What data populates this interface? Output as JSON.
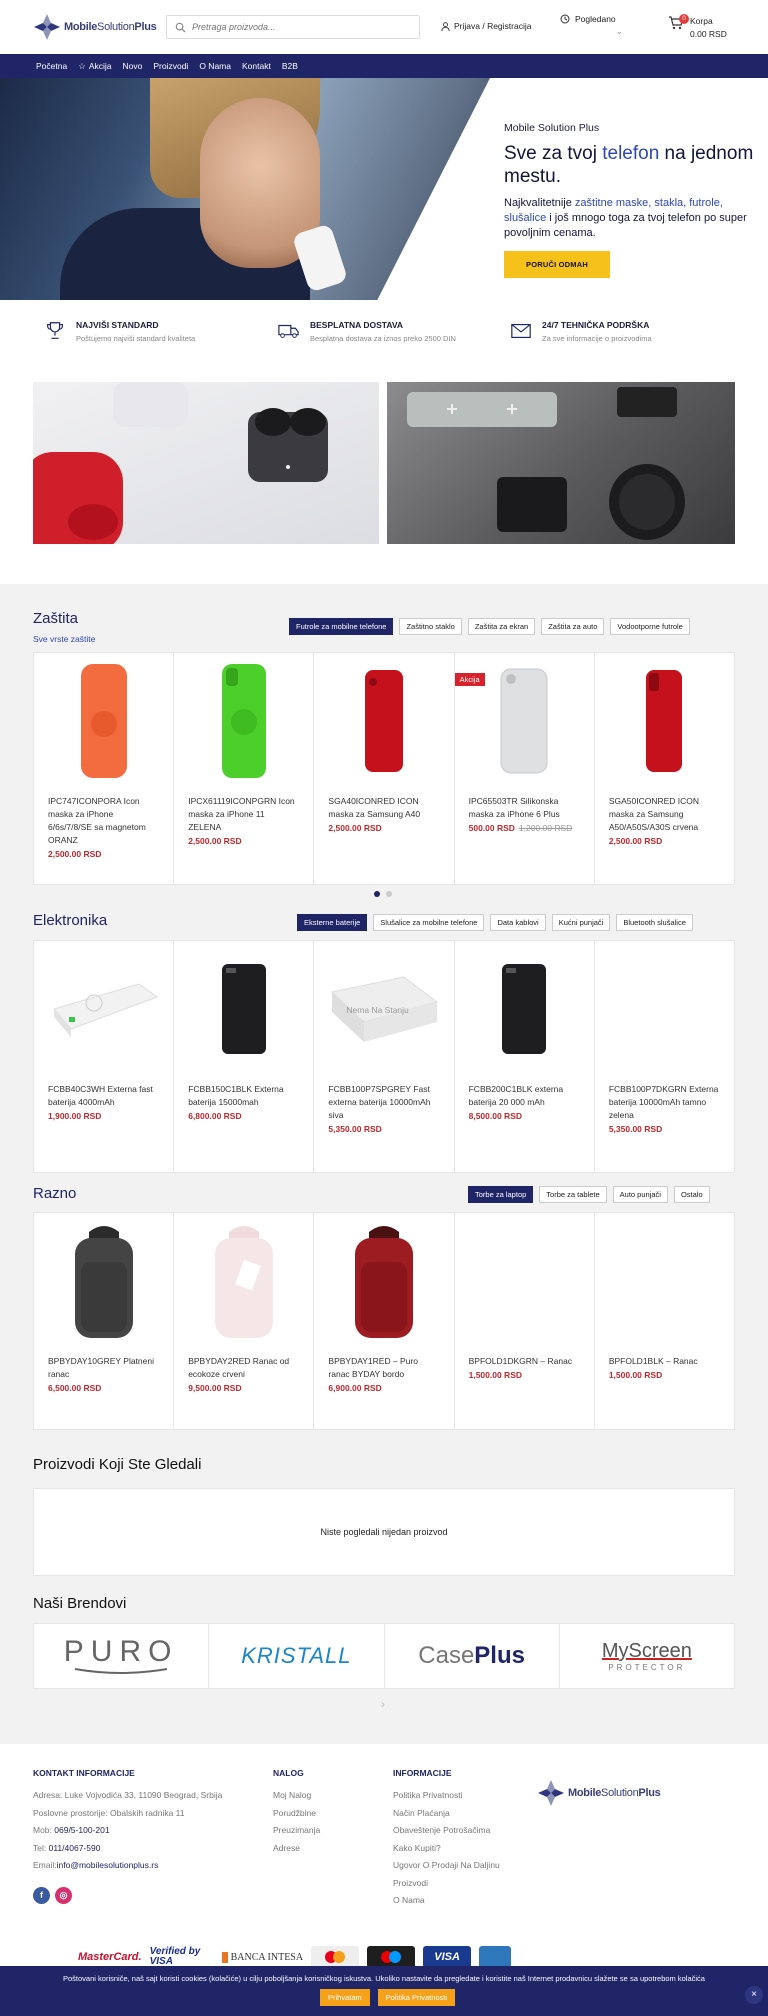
{
  "header": {
    "logo_text_a": "Mobile",
    "logo_text_b": "Solution",
    "logo_text_c": "Plus",
    "search_placeholder": "Pretraga proizvoda...",
    "login_label": "Prijava / Registracija",
    "viewed_label": "Pogledano",
    "cart_label": "Korpa",
    "cart_total": "0.00 RSD",
    "cart_count": "0"
  },
  "nav": {
    "items": [
      "Početna",
      "Akcija",
      "Novo",
      "Proizvodi",
      "O Nama",
      "Kontakt",
      "B2B"
    ]
  },
  "hero": {
    "kicker": "Mobile Solution Plus",
    "title_a": "Sve za tvoj ",
    "title_hl": "telefon",
    "title_b": " na jednom mestu.",
    "text_a": "Najkvalitetnije ",
    "text_hl1": "zaštitne maske, stakla, futrole, slušalice",
    "text_b": " i još mnogo toga za tvoj telefon po super povoljnim cenama.",
    "button": "PORUČI ODMAH"
  },
  "features": [
    {
      "title": "NAJVIŠI STANDARD",
      "sub": "Poštujemo najviši standard kvaliteta",
      "icon": "trophy-icon"
    },
    {
      "title": "BESPLATNA DOSTAVA",
      "sub": "Besplatna dostava za iznos preko 2500 DIN",
      "icon": "truck-icon"
    },
    {
      "title": "24/7 TEHNIČKA PODRŠKA",
      "sub": "Za sve informacije o proizvodima",
      "icon": "mail-icon"
    }
  ],
  "zastita": {
    "title": "Zaštita",
    "sub": "Sve vrste zaštite",
    "tabs": [
      "Futrole za mobilne telefone",
      "Zaštitno staklo",
      "Zaštita za ekran",
      "Zaštita za auto",
      "Vodootporne futrole"
    ],
    "products": [
      {
        "name": "IPC747ICONPORA Icon maska za iPhone 6/6s/7/8/SE sa magnetom ORANZ",
        "price": "2,500.00 RSD",
        "old": "",
        "badge": ""
      },
      {
        "name": "IPCX61119ICONPGRN Icon maska za iPhone 11 ZELENA",
        "price": "2,500.00 RSD",
        "old": "",
        "badge": ""
      },
      {
        "name": "SGA40ICONRED ICON maska za Samsung A40",
        "price": "2,500.00 RSD",
        "old": "",
        "badge": ""
      },
      {
        "name": "IPC65503TR Silikonska maska za iPhone 6 Plus",
        "price": "500.00 RSD",
        "old": "1,200.00 RSD",
        "badge": "Akcija"
      },
      {
        "name": "SGA50ICONRED ICON maska za Samsung A50/A50S/A30S crvena",
        "price": "2,500.00 RSD",
        "old": "",
        "badge": ""
      }
    ]
  },
  "elektronika": {
    "title": "Elektronika",
    "tabs": [
      "Eksterne baterije",
      "Slušalice za mobilne telefone",
      "Data kablovi",
      "Kućni punjači",
      "Bluetooth slušalice"
    ],
    "products": [
      {
        "name": "FCBB40C3WH Externa fast baterija 4000mAh",
        "price": "1,900.00 RSD"
      },
      {
        "name": "FCBB150C1BLK Externa baterija 15000mah",
        "price": "6,800.00 RSD"
      },
      {
        "name": "FCBB100P7SPGREY Fast externa baterija 10000mAh siva",
        "price": "5,350.00 RSD",
        "overlay": "Nema Na Stanju"
      },
      {
        "name": "FCBB200C1BLK externa baterija 20 000 mAh",
        "price": "8,500.00 RSD"
      },
      {
        "name": "FCBB100P7DKGRN Externa baterija 10000mAh tamno zelena",
        "price": "5,350.00 RSD"
      }
    ]
  },
  "razno": {
    "title": "Razno",
    "tabs": [
      "Torbe za laptop",
      "Torbe za tablete",
      "Auto punjači",
      "Ostalo"
    ],
    "products": [
      {
        "name": "BPBYDAY10GREY Platneni ranac",
        "price": "6,500.00 RSD"
      },
      {
        "name": "BPBYDAY2RED Ranac od ecokoze crveni",
        "price": "9,500.00 RSD"
      },
      {
        "name": "BPBYDAY1RED – Puro ranac BYDAY bordo",
        "price": "6,900.00 RSD"
      },
      {
        "name": "BPFOLD1DKGRN – Ranac",
        "price": "1,500.00 RSD"
      },
      {
        "name": "BPFOLD1BLK – Ranac",
        "price": "1,500.00 RSD"
      }
    ]
  },
  "viewed": {
    "title": "Proizvodi Koji Ste Gledali",
    "empty": "Niste pogledali nijedan proizvod"
  },
  "brands": {
    "title": "Naši Brendovi",
    "items": [
      "PURO",
      "KRISTALL",
      "Case",
      "Plus",
      "MyScreen",
      "PROTECTOR"
    ]
  },
  "footer": {
    "contact_title": "KONTAKT INFORMACIJE",
    "address": "Adresa: Luke Vojvodića 33, 11090 Beograd, Srbija",
    "office": "Poslovne prostorije: Obalskih radnika 11",
    "mob_label": "Mob: ",
    "mob": "069/5-100-201",
    "tel_label": "Tel: ",
    "tel": "011/4067-590",
    "email_label": "Email:",
    "email": "info@mobilesolutionplus.rs",
    "account_title": "NALOG",
    "account_links": [
      "Moj Nalog",
      "Porudžbine",
      "Preuzimanja",
      "Adrese"
    ],
    "info_title": "INFORMACIJE",
    "info_links": [
      "Politika Privatnosti",
      "Način Plaćanja",
      "Obaveštenje Potrošačima",
      "Kako Kupiti?",
      "Ugovor O Prodaji Na Daljinu",
      "Proizvodi",
      "O Nama"
    ]
  },
  "payments": [
    "MasterCard.",
    "Verified by VISA",
    "BANCA INTESA",
    "VISA"
  ],
  "cookie": {
    "text": "Poštovani korisniče, naš sajt koristi cookies (kolačiće) u cilju poboljšanja korisničkog iskustva. Ukoliko nastavite da pregledate i koristite naš Internet prodavnicu slažete se sa upotrebom kolačića",
    "accept": "Prihvatam",
    "privacy": "Politika Privatnosti"
  },
  "colors": {
    "brand": "#1f2566",
    "accent": "#2e47b7",
    "price": "#c0282d",
    "button": "#f6c11a"
  }
}
